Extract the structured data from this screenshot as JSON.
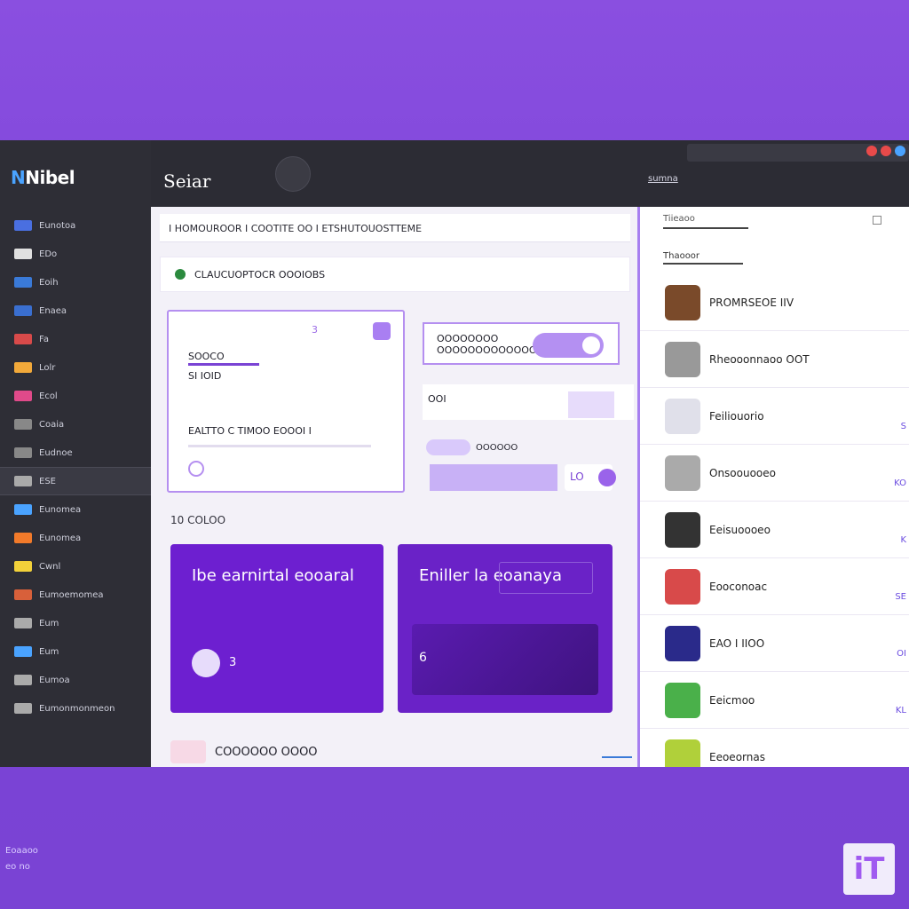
{
  "app": {
    "logo": "Nibel",
    "page_title": "Seiar",
    "top_link": "sumna"
  },
  "sidebar": {
    "items": [
      {
        "label": "Eunotoa",
        "color": "#4a6fe0"
      },
      {
        "label": "EDo",
        "color": "#e0e0e0"
      },
      {
        "label": "Eoih",
        "color": "#3a7ad8"
      },
      {
        "label": "Enaea",
        "color": "#3a6fd0"
      },
      {
        "label": "Fa",
        "color": "#d84a4a"
      },
      {
        "label": "Lolr",
        "color": "#f2a93a"
      },
      {
        "label": "Ecol",
        "color": "#e04a8a"
      },
      {
        "label": "Coaia",
        "color": "#888"
      },
      {
        "label": "Eudnoe",
        "color": "#888"
      },
      {
        "label": "ESE",
        "color": "#aaa"
      },
      {
        "label": "Eunomea",
        "color": "#4aa3ff"
      },
      {
        "label": "Eunomea",
        "color": "#f27a2a"
      },
      {
        "label": "Cwnl",
        "color": "#f2d13a"
      },
      {
        "label": "Eumoemomea",
        "color": "#d8603a"
      },
      {
        "label": "Eum",
        "color": "#aaa"
      },
      {
        "label": "Eum",
        "color": "#4aa3ff"
      },
      {
        "label": "Eumoa",
        "color": "#aaa"
      },
      {
        "label": "Eumonmonmeon",
        "color": "#aaa"
      }
    ]
  },
  "main": {
    "header": "I HOMOUROOR I COOTITE OO I ETSHUTOUOSTTEME",
    "status": "CLAUCUOPTOCR OOOIOBS",
    "card": {
      "count": "3",
      "line1": "SOOCO",
      "line2": "SI IOID",
      "line3": "EALTTO C TIMOO EOOOI I"
    },
    "panel": {
      "title": "OOOOOOOO",
      "subtitle": "OOOOOOOOOOOOO"
    },
    "row2": "OOI",
    "row3_label": "OOOOOO",
    "lo_button": "LO",
    "section_label": "10 COLOO",
    "promo_a": {
      "title": "Ibe earnirtal eooaral",
      "meta": "3"
    },
    "promo_b": {
      "title": "Eniller la eoanaya",
      "meta": "6"
    },
    "footer": "COOOOOO OOOO"
  },
  "right": {
    "heading": "Tiieaoo",
    "subheading": "Thaooor",
    "contacts": [
      {
        "name": "PROMRSEOE IIV",
        "side": "",
        "color": "#7a4a2a"
      },
      {
        "name": "Rheooonnaoo OOT",
        "side": "",
        "color": "#999"
      },
      {
        "name": "Feiliouorio",
        "side": "S",
        "color": "#e0e0ea"
      },
      {
        "name": "Onsoouooeo",
        "side": "KO",
        "color": "#aaa"
      },
      {
        "name": "Eeisuoooeo",
        "side": "K",
        "color": "#333"
      },
      {
        "name": "Eooconoac",
        "side": "SE",
        "color": "#d84a4a"
      },
      {
        "name": "EAO I IIOO",
        "side": "OI",
        "color": "#2a2a8a"
      },
      {
        "name": "Eeicmoo",
        "side": "KL",
        "color": "#4ab04a"
      },
      {
        "name": "Eeoeornas",
        "side": "",
        "color": "#b0d03a"
      }
    ]
  },
  "watermark": "iT",
  "corner": [
    "Eoaaoo",
    "eo no"
  ]
}
